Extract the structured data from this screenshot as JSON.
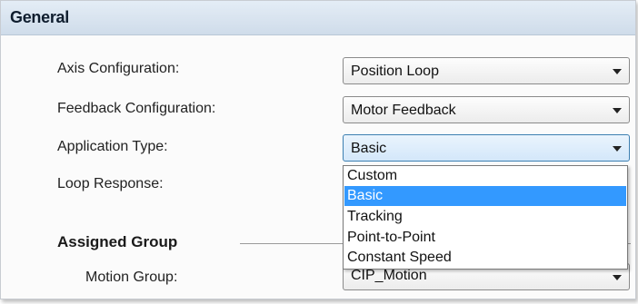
{
  "header": {
    "title": "General"
  },
  "fields": [
    {
      "label": "Axis Configuration:",
      "value": "Position Loop"
    },
    {
      "label": "Feedback Configuration:",
      "value": "Motor Feedback"
    },
    {
      "label": "Application Type:",
      "value": "Basic"
    },
    {
      "label": "Loop Response:"
    }
  ],
  "assigned_group": {
    "heading": "Assigned Group",
    "motion_group_label": "Motion Group:",
    "motion_group_value": "CIP_Motion"
  },
  "dropdown": {
    "options": [
      "Custom",
      "Basic",
      "Tracking",
      "Point-to-Point",
      "Constant Speed"
    ],
    "selected": "Basic"
  },
  "colors": {
    "selection_highlight": "#3399ff",
    "header_background": "#d6e2ef"
  }
}
